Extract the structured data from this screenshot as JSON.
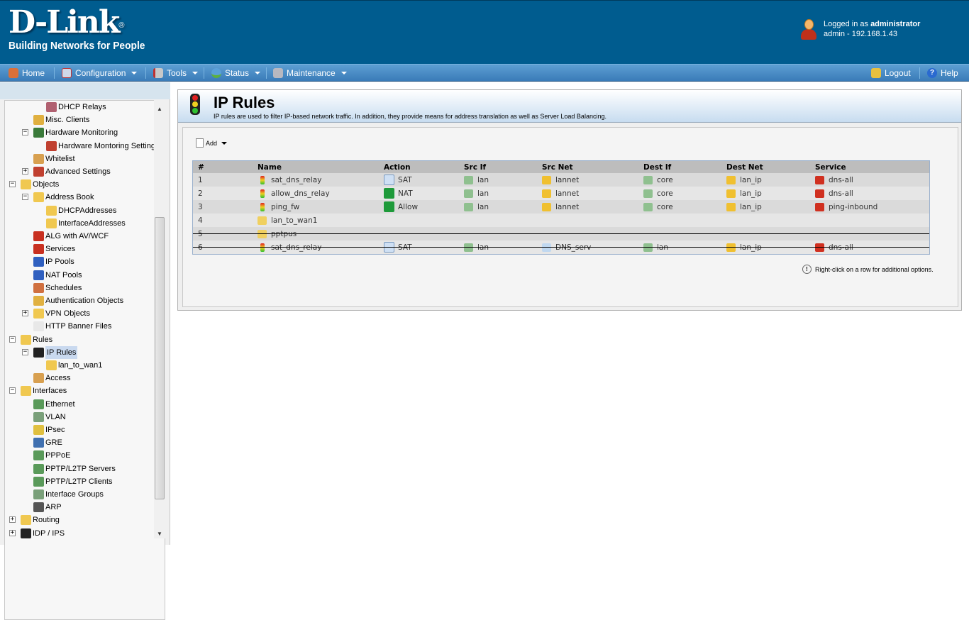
{
  "brand": {
    "logo": "D-Link",
    "tagline": "Building Networks for People"
  },
  "user": {
    "logged_prefix": "Logged in as ",
    "username": "administrator",
    "session": "admin - 192.168.1.43"
  },
  "nav": {
    "home": "Home",
    "configuration": "Configuration",
    "tools": "Tools",
    "status": "Status",
    "maintenance": "Maintenance",
    "logout": "Logout",
    "help": "Help"
  },
  "tree": [
    {
      "label": "DHCP Relays",
      "level": 3,
      "icon": "dhcp-relay-icon",
      "color": "#b06070"
    },
    {
      "label": "Misc. Clients",
      "level": 2,
      "icon": "misc-clients-icon",
      "color": "#e0b040"
    },
    {
      "label": "Hardware Monitoring",
      "level": 2,
      "icon": "hardware-icon",
      "color": "#3a7a3a",
      "expander": "-"
    },
    {
      "label": "Hardware Montoring Setting",
      "level": 3,
      "icon": "tools-icon",
      "color": "#c04030"
    },
    {
      "label": "Whitelist",
      "level": 2,
      "icon": "whitelist-icon",
      "color": "#d8a050"
    },
    {
      "label": "Advanced Settings",
      "level": 2,
      "icon": "tools-icon",
      "color": "#c04030",
      "expander": "+"
    },
    {
      "label": "Objects",
      "level": 1,
      "icon": "folder-icon",
      "color": "#f0c850",
      "expander": "-"
    },
    {
      "label": "Address Book",
      "level": 2,
      "icon": "folder-icon",
      "color": "#f0c850",
      "expander": "-"
    },
    {
      "label": "DHCPAddresses",
      "level": 3,
      "icon": "folder-icon",
      "color": "#f0c850"
    },
    {
      "label": "InterfaceAddresses",
      "level": 3,
      "icon": "folder-icon",
      "color": "#f0c850"
    },
    {
      "label": "ALG with AV/WCF",
      "level": 2,
      "icon": "alg-icon",
      "color": "#c83020"
    },
    {
      "label": "Services",
      "level": 2,
      "icon": "services-icon",
      "color": "#c83020"
    },
    {
      "label": "IP Pools",
      "level": 2,
      "icon": "ip-pools-icon",
      "color": "#3060c0"
    },
    {
      "label": "NAT Pools",
      "level": 2,
      "icon": "nat-pools-icon",
      "color": "#3060c0"
    },
    {
      "label": "Schedules",
      "level": 2,
      "icon": "schedules-icon",
      "color": "#d07040"
    },
    {
      "label": "Authentication Objects",
      "level": 2,
      "icon": "auth-icon",
      "color": "#e0b040"
    },
    {
      "label": "VPN Objects",
      "level": 2,
      "icon": "folder-icon",
      "color": "#f0c850",
      "expander": "+"
    },
    {
      "label": "HTTP Banner Files",
      "level": 2,
      "icon": "file-icon",
      "color": "#e8e8e8"
    },
    {
      "label": "Rules",
      "level": 1,
      "icon": "folder-icon",
      "color": "#f0c850",
      "expander": "-"
    },
    {
      "label": "IP Rules",
      "level": 2,
      "icon": "traffic-light-icon",
      "color": "#222",
      "expander": "-",
      "selected": true
    },
    {
      "label": "lan_to_wan1",
      "level": 3,
      "icon": "folder-icon",
      "color": "#f0c850"
    },
    {
      "label": "Access",
      "level": 2,
      "icon": "access-icon",
      "color": "#d8a050"
    },
    {
      "label": "Interfaces",
      "level": 1,
      "icon": "folder-icon",
      "color": "#f0c850",
      "expander": "-"
    },
    {
      "label": "Ethernet",
      "level": 2,
      "icon": "ethernet-icon",
      "color": "#5a9a5a"
    },
    {
      "label": "VLAN",
      "level": 2,
      "icon": "vlan-icon",
      "color": "#7aa07a"
    },
    {
      "label": "IPsec",
      "level": 2,
      "icon": "lock-icon",
      "color": "#e0c040"
    },
    {
      "label": "GRE",
      "level": 2,
      "icon": "gre-icon",
      "color": "#4070b0"
    },
    {
      "label": "PPPoE",
      "level": 2,
      "icon": "pppoe-icon",
      "color": "#5a9a5a"
    },
    {
      "label": "PPTP/L2TP Servers",
      "level": 2,
      "icon": "pptp-server-icon",
      "color": "#5a9a5a"
    },
    {
      "label": "PPTP/L2TP Clients",
      "level": 2,
      "icon": "pptp-client-icon",
      "color": "#5a9a5a"
    },
    {
      "label": "Interface Groups",
      "level": 2,
      "icon": "interface-groups-icon",
      "color": "#7aa07a"
    },
    {
      "label": "ARP",
      "level": 2,
      "icon": "arp-icon",
      "color": "#555"
    },
    {
      "label": "Routing",
      "level": 1,
      "icon": "folder-icon",
      "color": "#f0c850",
      "expander": "+"
    },
    {
      "label": "IDP / IPS",
      "level": 1,
      "icon": "idp-icon",
      "color": "#222",
      "expander": "+"
    }
  ],
  "page": {
    "title": "IP Rules",
    "description": "IP rules are used to filter IP-based network traffic. In addition, they provide means for address translation as well as Server Load Balancing.",
    "add_label": "Add",
    "hint": "Right-click on a row for additional options."
  },
  "table": {
    "headers": [
      "#",
      "Name",
      "Action",
      "Src If",
      "Src Net",
      "Dest If",
      "Dest Net",
      "Service"
    ],
    "rows": [
      {
        "num": "1",
        "name": "sat_dns_relay",
        "name_icon": "traffic-light-icon",
        "action": "SAT",
        "action_icon": "sat-icon",
        "src_if": "lan",
        "src_net": "lannet",
        "dest_if": "core",
        "dest_net": "lan_ip",
        "service": "dns-all",
        "disabled": false
      },
      {
        "num": "2",
        "name": "allow_dns_relay",
        "name_icon": "traffic-light-icon",
        "action": "NAT",
        "action_icon": "nat-icon",
        "src_if": "lan",
        "src_net": "lannet",
        "dest_if": "core",
        "dest_net": "lan_ip",
        "service": "dns-all",
        "disabled": false
      },
      {
        "num": "3",
        "name": "ping_fw",
        "name_icon": "traffic-light-icon",
        "action": "Allow",
        "action_icon": "allow-icon",
        "src_if": "lan",
        "src_net": "lannet",
        "dest_if": "core",
        "dest_net": "lan_ip",
        "service": "ping-inbound",
        "disabled": false
      },
      {
        "num": "4",
        "name": "lan_to_wan1",
        "name_icon": "folder-icon",
        "action": "",
        "src_if": "",
        "src_net": "",
        "dest_if": "",
        "dest_net": "",
        "service": "",
        "disabled": false
      },
      {
        "num": "5",
        "name": "pptpus",
        "name_icon": "folder-icon",
        "action": "",
        "src_if": "",
        "src_net": "",
        "dest_if": "",
        "dest_net": "",
        "service": "",
        "disabled": true
      },
      {
        "num": "6",
        "name": "sat_dns_relay",
        "name_icon": "traffic-light-icon",
        "action": "SAT",
        "action_icon": "sat-icon",
        "src_if": "lan",
        "src_net": "DNS_serv",
        "dest_if": "lan",
        "dest_net": "lan_ip",
        "service": "dns-all",
        "disabled": true
      }
    ]
  },
  "colors": {
    "header_bg": "#005c8f",
    "nav_bg": "#3a7bb8",
    "selected": "#c9d9ef"
  }
}
